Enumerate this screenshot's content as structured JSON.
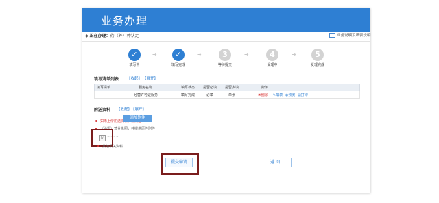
{
  "header": {
    "title": "业务办理"
  },
  "breadcrumb": {
    "label": "正在办理：",
    "value": "药（养）种认定"
  },
  "help": {
    "label": "业务说明及填表说明"
  },
  "steps": [
    {
      "label": "填写中",
      "state": "done",
      "mark": "✓"
    },
    {
      "label": "填写完成",
      "state": "done",
      "mark": "✓"
    },
    {
      "label": "等待提交",
      "state": "todo",
      "mark": "3"
    },
    {
      "label": "受理中",
      "state": "todo",
      "mark": "4"
    },
    {
      "label": "受理完成",
      "state": "todo",
      "mark": "5"
    }
  ],
  "form_list": {
    "title": "填写清单列表",
    "links": [
      "【收起】",
      "【展开】"
    ],
    "columns": [
      "填写清单",
      "服务名称",
      "填写状态",
      "是否必填",
      "是否多填",
      "操作"
    ],
    "rows": [
      {
        "no": "1",
        "name": "经营许可证服务",
        "status": "填写完成",
        "required": "必填",
        "multi": "单张",
        "actions": [
          "删除",
          "填表",
          "预览",
          "打印"
        ]
      }
    ]
  },
  "attachments": {
    "title": "附送资料",
    "links": [
      "【收起】",
      "【展开】"
    ],
    "notice": "如未上传附送资料，请点击",
    "add_button": "添加附件",
    "item1": "（必需）营业执照，并提供原件附件",
    "item1_tag": "必需",
    "checkbox_mark": "☑",
    "checkbox_label": "~~~~",
    "item3": "其他相关资料"
  },
  "buttons": {
    "submit": "提交申请",
    "back": "返 回"
  },
  "colors": {
    "header": "#2e7fd3",
    "highlight": "#7a1d1d",
    "warning": "#d83a3a"
  }
}
